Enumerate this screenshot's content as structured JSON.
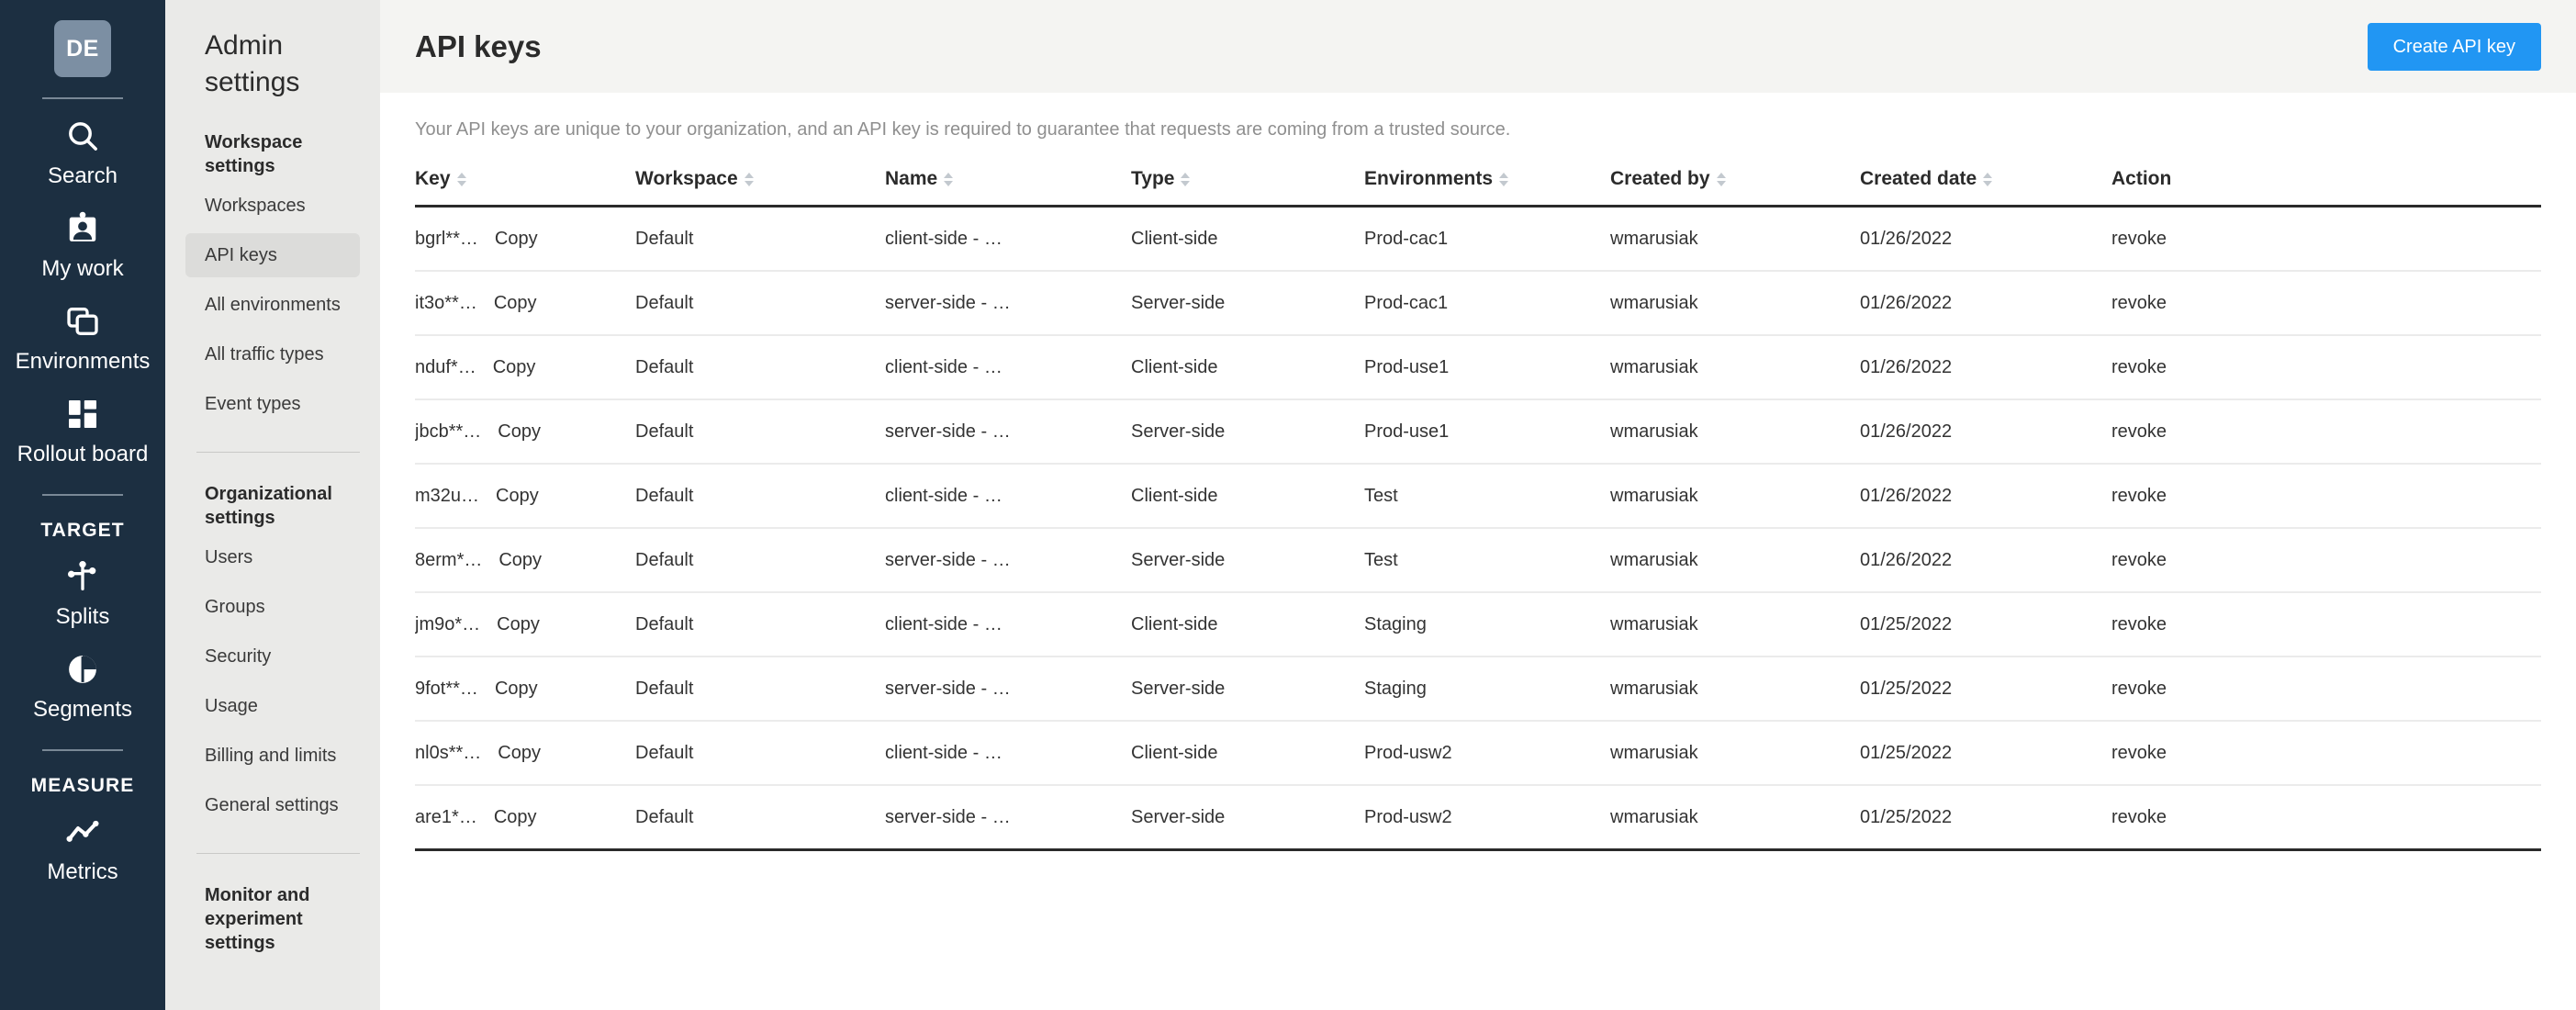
{
  "rail": {
    "avatar_initials": "DE",
    "items": [
      {
        "label": "Search",
        "icon": "search-icon"
      },
      {
        "label": "My work",
        "icon": "my-work-icon"
      },
      {
        "label": "Environments",
        "icon": "environments-icon"
      },
      {
        "label": "Rollout board",
        "icon": "rollout-board-icon"
      }
    ],
    "sections": [
      {
        "title": "TARGET",
        "items": [
          {
            "label": "Splits",
            "icon": "splits-icon"
          },
          {
            "label": "Segments",
            "icon": "segments-icon"
          }
        ]
      },
      {
        "title": "MEASURE",
        "items": [
          {
            "label": "Metrics",
            "icon": "metrics-icon"
          }
        ]
      }
    ]
  },
  "settings_nav": {
    "title": "Admin settings",
    "groups": [
      {
        "title": "Workspace settings",
        "items": [
          {
            "label": "Workspaces",
            "active": false
          },
          {
            "label": "API keys",
            "active": true
          },
          {
            "label": "All environments",
            "active": false
          },
          {
            "label": "All traffic types",
            "active": false
          },
          {
            "label": "Event types",
            "active": false
          }
        ]
      },
      {
        "title": "Organizational settings",
        "items": [
          {
            "label": "Users",
            "active": false
          },
          {
            "label": "Groups",
            "active": false
          },
          {
            "label": "Security",
            "active": false
          },
          {
            "label": "Usage",
            "active": false
          },
          {
            "label": "Billing and limits",
            "active": false
          },
          {
            "label": "General settings",
            "active": false
          }
        ]
      },
      {
        "title": "Monitor and experiment settings",
        "items": []
      }
    ]
  },
  "header": {
    "title": "API keys",
    "create_button_label": "Create API key",
    "accent_color": "#2196f3"
  },
  "content": {
    "description": "Your API keys are unique to your organization, and an API key is required to guarantee that requests are coming from a trusted source.",
    "copy_label": "Copy",
    "revoke_label": "revoke",
    "columns": [
      {
        "label": "Key",
        "sortable": true
      },
      {
        "label": "Workspace",
        "sortable": true
      },
      {
        "label": "Name",
        "sortable": true
      },
      {
        "label": "Type",
        "sortable": true
      },
      {
        "label": "Environments",
        "sortable": true
      },
      {
        "label": "Created by",
        "sortable": true
      },
      {
        "label": "Created date",
        "sortable": true
      },
      {
        "label": "Action",
        "sortable": false
      }
    ],
    "rows": [
      {
        "key": "bgrl**…",
        "workspace": "Default",
        "name": "client-side - …",
        "type": "Client-side",
        "environments": "Prod-cac1",
        "created_by": "wmarusiak",
        "created_date": "01/26/2022"
      },
      {
        "key": "it3o**…",
        "workspace": "Default",
        "name": "server-side - …",
        "type": "Server-side",
        "environments": "Prod-cac1",
        "created_by": "wmarusiak",
        "created_date": "01/26/2022"
      },
      {
        "key": "nduf*…",
        "workspace": "Default",
        "name": "client-side - …",
        "type": "Client-side",
        "environments": "Prod-use1",
        "created_by": "wmarusiak",
        "created_date": "01/26/2022"
      },
      {
        "key": "jbcb**…",
        "workspace": "Default",
        "name": "server-side - …",
        "type": "Server-side",
        "environments": "Prod-use1",
        "created_by": "wmarusiak",
        "created_date": "01/26/2022"
      },
      {
        "key": "m32u…",
        "workspace": "Default",
        "name": "client-side - …",
        "type": "Client-side",
        "environments": "Test",
        "created_by": "wmarusiak",
        "created_date": "01/26/2022"
      },
      {
        "key": "8erm*…",
        "workspace": "Default",
        "name": "server-side - …",
        "type": "Server-side",
        "environments": "Test",
        "created_by": "wmarusiak",
        "created_date": "01/26/2022"
      },
      {
        "key": "jm9o*…",
        "workspace": "Default",
        "name": "client-side - …",
        "type": "Client-side",
        "environments": "Staging",
        "created_by": "wmarusiak",
        "created_date": "01/25/2022"
      },
      {
        "key": "9fot**…",
        "workspace": "Default",
        "name": "server-side - …",
        "type": "Server-side",
        "environments": "Staging",
        "created_by": "wmarusiak",
        "created_date": "01/25/2022"
      },
      {
        "key": "nl0s**…",
        "workspace": "Default",
        "name": "client-side - …",
        "type": "Client-side",
        "environments": "Prod-usw2",
        "created_by": "wmarusiak",
        "created_date": "01/25/2022"
      },
      {
        "key": "are1*…",
        "workspace": "Default",
        "name": "server-side - …",
        "type": "Server-side",
        "environments": "Prod-usw2",
        "created_by": "wmarusiak",
        "created_date": "01/25/2022"
      }
    ]
  }
}
